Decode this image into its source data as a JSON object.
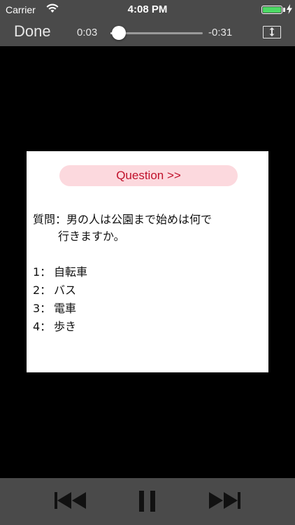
{
  "status_bar": {
    "carrier": "Carrier",
    "time": "4:08 PM",
    "battery_color": "#4cd964",
    "icons": [
      "wifi-icon",
      "battery-icon",
      "charging-bolt-icon"
    ]
  },
  "player": {
    "done_label": "Done",
    "time_elapsed": "0:03",
    "time_remaining": "-0:31",
    "progress_fraction": 0.09,
    "icons": [
      "aspect-toggle-icon",
      "skip-back-icon",
      "pause-icon",
      "skip-forward-icon"
    ]
  },
  "slide": {
    "banner": "Question >>",
    "question_label": "質問：",
    "question_line1": "男の人は公園まで始めは何で",
    "question_line2": "行きますか。",
    "choices": [
      {
        "num": "1：",
        "text": "自転車"
      },
      {
        "num": "2：",
        "text": "バス"
      },
      {
        "num": "3：",
        "text": "電車"
      },
      {
        "num": "4：",
        "text": "歩き"
      }
    ],
    "banner_bg": "#fcd9de",
    "banner_text_color": "#c0112b"
  }
}
